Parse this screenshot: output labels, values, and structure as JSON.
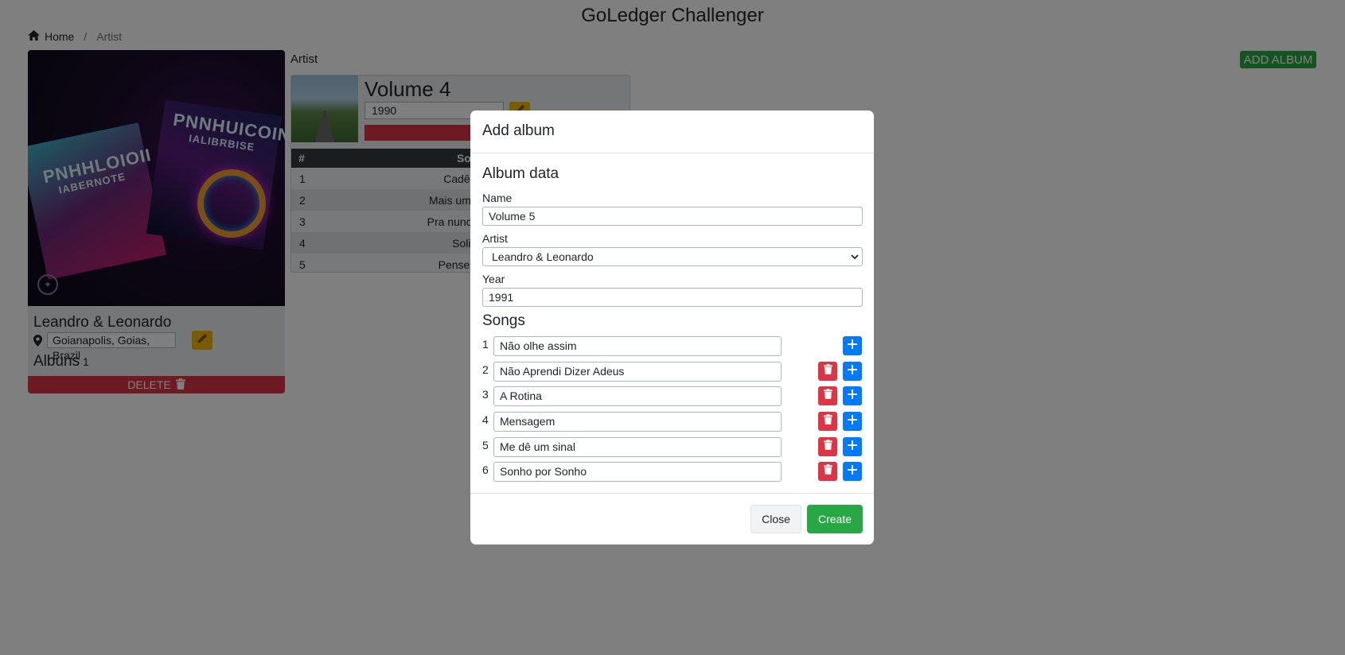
{
  "app": {
    "title": "GoLedger Challenger"
  },
  "breadcrumb": {
    "home": "Home",
    "current": "Artist"
  },
  "header": {
    "add_album_label": "ADD ALBUM"
  },
  "artist": {
    "name": "Leandro & Leonardo",
    "location": "Goianapolis, Goias, Brazil",
    "albums_label": "Albuns",
    "albums_count": "1",
    "delete_label": "DELETE",
    "cover_text_left": "PNHHLOIOII",
    "cover_sub_left": "IABERNOTE",
    "cover_text_right": "PNNHUICOIN",
    "cover_sub_right": "IALIBRBISE"
  },
  "album_section": {
    "label": "Artist",
    "album_name": "Volume 4",
    "album_year": "1990",
    "columns": [
      "#",
      "Song"
    ],
    "rows": [
      {
        "num": "1",
        "song": "Cadê Você"
      },
      {
        "num": "2",
        "song": "Mais uma vez so"
      },
      {
        "num": "3",
        "song": "Pra nunca dizer a"
      },
      {
        "num": "4",
        "song": "Solidão"
      },
      {
        "num": "5",
        "song": "Pense em mi"
      }
    ]
  },
  "modal": {
    "title": "Add album",
    "section_title": "Album data",
    "name_label": "Name",
    "name_value": "Volume 5",
    "artist_label": "Artist",
    "artist_value": "Leandro & Leonardo",
    "year_label": "Year",
    "year_value": "1991",
    "songs_title": "Songs",
    "songs": [
      {
        "num": "1",
        "value": "Não olhe assim"
      },
      {
        "num": "2",
        "value": "Não Aprendi Dizer Adeus"
      },
      {
        "num": "3",
        "value": "A Rotina"
      },
      {
        "num": "4",
        "value": "Mensagem"
      },
      {
        "num": "5",
        "value": "Me dê um sinal"
      },
      {
        "num": "6",
        "value": "Sonho por Sonho"
      }
    ],
    "close_label": "Close",
    "create_label": "Create"
  },
  "colors": {
    "success": "#28a745",
    "danger": "#dc3545",
    "primary": "#007bff",
    "warning": "#f2b705",
    "table_header": "#343a40"
  },
  "icons": {
    "home": "home-icon",
    "pin": "map-pin-icon",
    "edit": "pencil-icon",
    "trash": "trash-icon",
    "plus": "plus-icon",
    "chevron": "chevron-down-icon"
  }
}
